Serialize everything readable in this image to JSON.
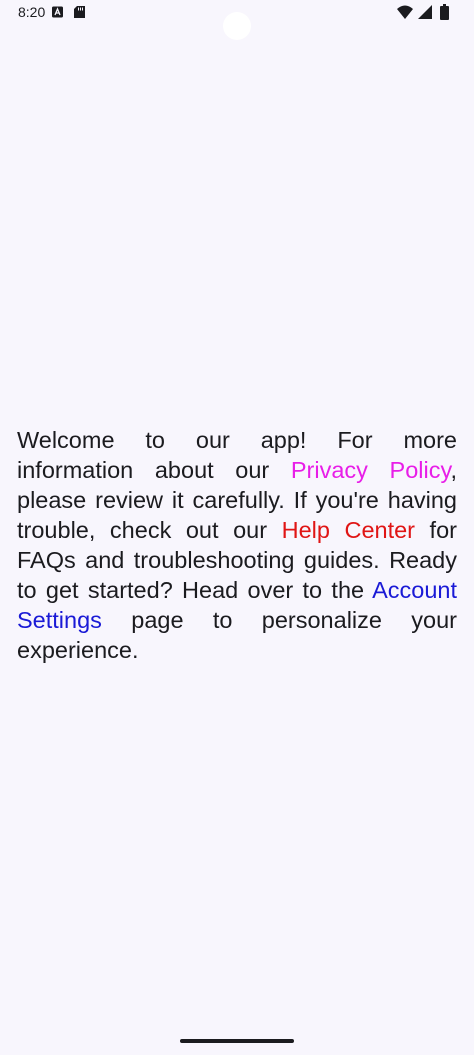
{
  "status_bar": {
    "time": "8:20",
    "icons": [
      "notification-a-icon",
      "sd-card-icon",
      "wifi-icon",
      "signal-icon",
      "battery-icon"
    ]
  },
  "content": {
    "segments": {
      "s1": "Welcome to our app! For more information about our ",
      "privacy_link": "Privacy Policy",
      "s2": ", please review it carefully. If you're having trouble, check out our ",
      "help_link": "Help Center",
      "s3": " for FAQs and troubleshooting guides. Ready to get started? Head over to the ",
      "account_link": "Account Settings",
      "s4": " page to personalize your experience."
    }
  },
  "colors": {
    "background": "#f8f6fd",
    "text": "#1b1b1f",
    "privacy_link": "#e81ee8",
    "help_link": "#e01515",
    "account_link": "#1a1ad6"
  }
}
